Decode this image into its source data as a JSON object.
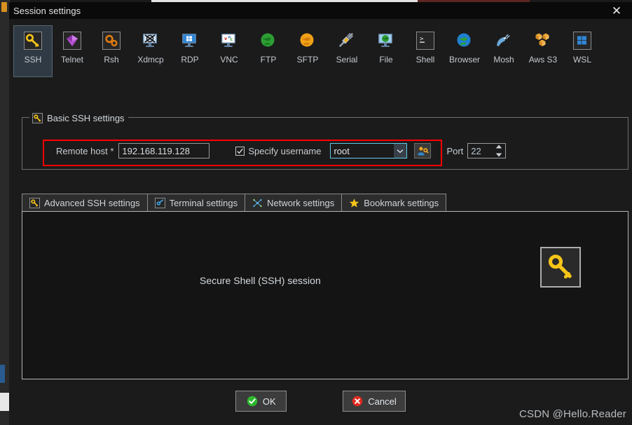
{
  "window": {
    "title": "Session settings",
    "close_label": "✕"
  },
  "protocols": {
    "selected": "SSH",
    "items": [
      {
        "label": "SSH",
        "icon": "key-icon"
      },
      {
        "label": "Telnet",
        "icon": "cube-icon"
      },
      {
        "label": "Rsh",
        "icon": "gears-icon"
      },
      {
        "label": "Xdmcp",
        "icon": "x-monitor-icon"
      },
      {
        "label": "RDP",
        "icon": "windows-monitor-icon"
      },
      {
        "label": "VNC",
        "icon": "vnc-monitor-icon"
      },
      {
        "label": "FTP",
        "icon": "green-globe-icon"
      },
      {
        "label": "SFTP",
        "icon": "orange-globe-icon"
      },
      {
        "label": "Serial",
        "icon": "plug-icon"
      },
      {
        "label": "File",
        "icon": "file-monitor-icon"
      },
      {
        "label": "Shell",
        "icon": "terminal-icon"
      },
      {
        "label": "Browser",
        "icon": "blue-globe-icon"
      },
      {
        "label": "Mosh",
        "icon": "satellite-icon"
      },
      {
        "label": "Aws S3",
        "icon": "aws-cubes-icon"
      },
      {
        "label": "WSL",
        "icon": "windows-icon"
      }
    ]
  },
  "basic_group": {
    "title": "Basic SSH settings",
    "icon": "key-icon",
    "remote_host_label": "Remote host *",
    "remote_host_value": "192.168.119.128",
    "remote_host_placeholder": "",
    "specify_username_label": "Specify username",
    "specify_username_checked": true,
    "username_value": "root",
    "username_options": [
      "root"
    ],
    "user_key_button_icon": "user-key-icon",
    "port_label": "Port",
    "port_value": "22"
  },
  "tabs": [
    {
      "label": "Advanced SSH settings",
      "icon": "key-icon",
      "active": false
    },
    {
      "label": "Terminal settings",
      "icon": "terminal-blue-icon",
      "active": false
    },
    {
      "label": "Network settings",
      "icon": "network-icon",
      "active": false
    },
    {
      "label": "Bookmark settings",
      "icon": "star-icon",
      "active": false
    }
  ],
  "panel": {
    "caption": "Secure Shell (SSH) session",
    "icon": "key-icon"
  },
  "buttons": {
    "ok_label": "OK",
    "ok_icon": "green-check-icon",
    "cancel_label": "Cancel",
    "cancel_icon": "red-x-icon"
  },
  "watermark": "CSDN @Hello.Reader",
  "colors": {
    "accent_red": "#ff0000",
    "focus_border": "#63c8e8",
    "key_yellow": "#f5c518",
    "ok_green": "#2eb82e",
    "cancel_red": "#e02b20",
    "window_bg": "#1b1b1b",
    "titlebar_bg": "#0a0a0a"
  }
}
